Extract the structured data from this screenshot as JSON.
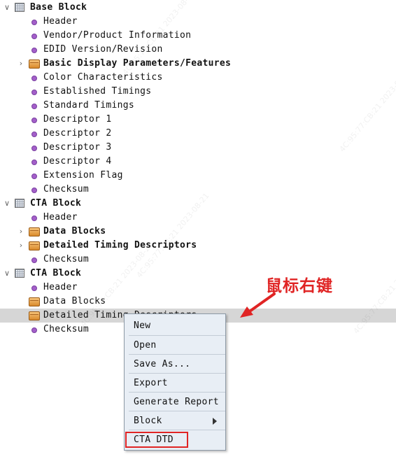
{
  "tree": {
    "base_block": {
      "label": "Base Block",
      "children": [
        "Header",
        "Vendor/Product Information",
        "EDID Version/Revision",
        "Basic Display Parameters/Features",
        "Color Characteristics",
        "Established Timings",
        "Standard Timings",
        "Descriptor 1",
        "Descriptor 2",
        "Descriptor 3",
        "Descriptor 4",
        "Extension Flag",
        "Checksum"
      ]
    },
    "cta_block_1": {
      "label": "CTA Block",
      "children": [
        "Header",
        "Data Blocks",
        "Detailed Timing Descriptors",
        "Checksum"
      ]
    },
    "cta_block_2": {
      "label": "CTA Block",
      "children": [
        "Header",
        "Data Blocks",
        "Detailed Timing Descriptors",
        "Checksum"
      ]
    }
  },
  "context_menu": {
    "items": [
      "New",
      "Open",
      "Save As...",
      "Export",
      "Generate Report",
      "Block",
      "CTA DTD"
    ]
  },
  "annotation": {
    "text": "鼠标右键"
  },
  "watermark": {
    "text": "4C:95:77:CB:21 2023-08-21"
  },
  "colors": {
    "selection": "#d6d6d6",
    "bullet": "#a35fc9",
    "folder": "#e0983a",
    "menu_bg": "#e8eef5",
    "annotation_red": "#e02424"
  },
  "icons": {
    "block": "grid-block-icon",
    "folder": "folder-icon",
    "leaf": "bullet-icon",
    "expanded": "chevron-down-icon",
    "collapsed": "chevron-right-icon",
    "submenu": "triangle-right-icon"
  }
}
